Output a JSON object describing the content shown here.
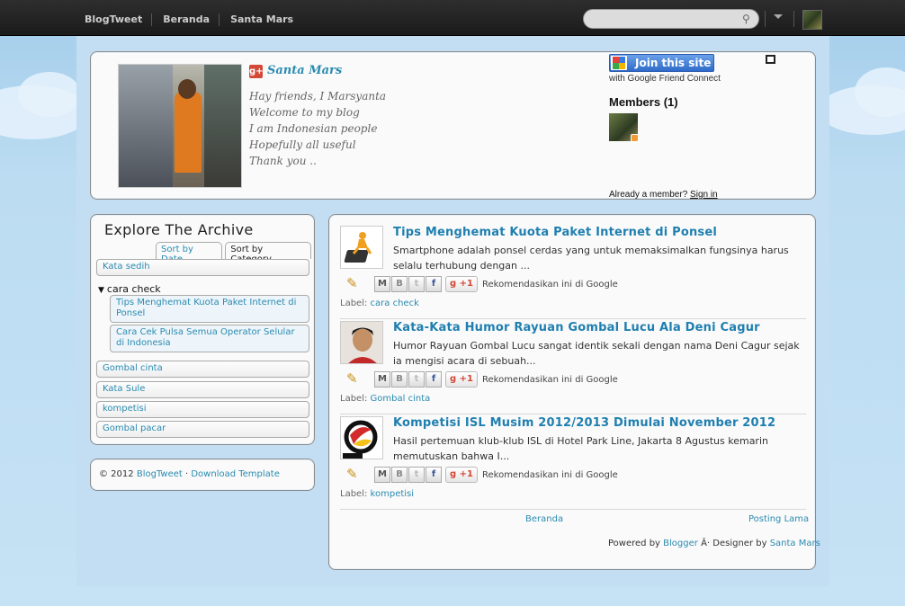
{
  "topbar": {
    "nav": [
      "BlogTweet",
      "Beranda",
      "Santa Mars"
    ],
    "search_placeholder": ""
  },
  "profile": {
    "name": "Santa Mars",
    "bio": [
      "Hay friends, I Marsyanta",
      "Welcome to my blog",
      "I am Indonesian people",
      "Hopefully all useful",
      "Thank you .."
    ]
  },
  "gfc": {
    "join_label": "Join this site",
    "sub_label": "with Google Friend Connect",
    "members_label": "Members (1)",
    "already_label": "Already a member?",
    "signin_label": "Sign in"
  },
  "archive": {
    "title": "Explore The Archive",
    "tab_date": "Sort by Date",
    "tab_category": "Sort by Category",
    "items": [
      "Kata sedih",
      "cara check",
      "Gombal cinta",
      "Kata Sule",
      "kompetisi",
      "Gombal pacar"
    ],
    "expanded_label": "cara check",
    "expanded_posts": [
      "Tips Menghemat Kuota Paket Internet di Ponsel",
      "Cara Cek Pulsa Semua Operator Selular di Indonesia"
    ]
  },
  "footer": {
    "copyright": "© 2012",
    "brand": "BlogTweet",
    "sep": "·",
    "download": "Download Template"
  },
  "posts": [
    {
      "title": "Tips Menghemat Kuota Paket Internet di Ponsel",
      "summary": "Smartphone adalah ponsel cerdas yang untuk memaksimalkan fungsinya harus selalu terhubung dengan ...",
      "label": "cara check"
    },
    {
      "title": "Kata-Kata Humor Rayuan Gombal Lucu Ala Deni Cagur",
      "summary": "Humor Rayuan Gombal Lucu sangat identik sekali dengan nama Deni Cagur sejak ia mengisi acara di sebuah...",
      "label": "Gombal cinta"
    },
    {
      "title": "Kompetisi ISL Musim 2012/2013 Dimulai November 2012",
      "summary": "Hasil pertemuan klub-klub ISL di Hotel Park Line, Jakarta 8 Agustus kemarin memutuskan bahwa I...",
      "label": "kompetisi"
    }
  ],
  "share": {
    "plusone": "+1",
    "recommend": "Rekomendasikan ini di Google",
    "label_prefix": "Label:"
  },
  "pager": {
    "home": "Beranda",
    "older": "Posting Lama"
  },
  "powered": {
    "prefix": "Powered by",
    "blogger": "Blogger",
    "mid": "Â· Designer by",
    "designer": "Santa Mars"
  },
  "colors": {
    "accent": "#2a8bb0",
    "title": "#1f7fb0",
    "topbar": "#1f1f1f"
  }
}
